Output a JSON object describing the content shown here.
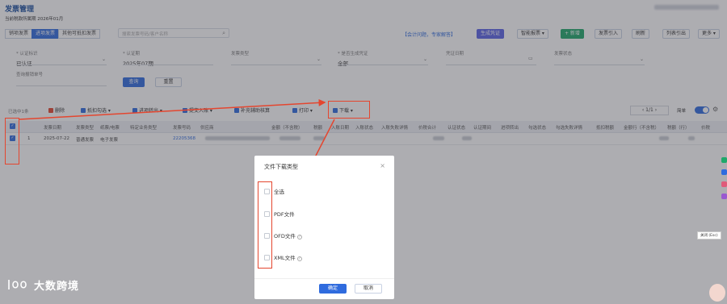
{
  "header": {
    "title": "发票管理",
    "subtitle": "当前税款所属期 2026年01月"
  },
  "tabs": [
    {
      "label": "销项发票"
    },
    {
      "label": "进项发票"
    },
    {
      "label": "其他可抵扣发票"
    }
  ],
  "search": {
    "placeholder": "搜索发票号码/客户名称"
  },
  "help_link": "【会计问题，专家解答】",
  "top_actions": {
    "generate": "生成凭证",
    "smart": "智能报票",
    "add": "+ 新增",
    "import": "发票引入",
    "refresh": "刷新",
    "export": "列表引出",
    "more": "更多"
  },
  "filters": {
    "cert_label": "* 认证标识",
    "cert_value": "已认证",
    "period_label": "* 认证期",
    "period_value": "2025年07期",
    "type_label": "发票类型",
    "voucher_label": "* 是否生成凭证",
    "voucher_value": "全部",
    "date_label": "凭证日期",
    "status_label": "发票状态",
    "invoice_no_label": "查询报销单号"
  },
  "buttons": {
    "query": "查询",
    "reset": "重置"
  },
  "toolbar": {
    "selected": "已选中1条",
    "delete": "删除",
    "deduct": "抵扣勾选",
    "transfer": "进项转出",
    "submit": "提交入账",
    "supplement": "补充辅助核算",
    "print": "打印",
    "download": "下载"
  },
  "pager": {
    "text": "1/1"
  },
  "toggle_label": "简单",
  "table": {
    "headers": [
      "发票日期",
      "发票类型",
      "纸票/电票",
      "特定业务类型",
      "发票号码",
      "供应商",
      "金额（不含税）",
      "税额",
      "入账日期",
      "入账状态",
      "入账失败详情",
      "价税合计",
      "认证状态",
      "认证期间",
      "进项转出",
      "勾选状态",
      "勾选失败详情",
      "抵扣税额",
      "金额行（不含税）",
      "税额（行）",
      "价税"
    ],
    "row": {
      "index": "1",
      "date": "2025-07-22",
      "type": "普通发票",
      "paper": "电子发票",
      "number": "22205368"
    }
  },
  "modal": {
    "title": "文件下载类型",
    "options": [
      "全选",
      "PDF文件",
      "OFD文件",
      "XML文件"
    ],
    "ok": "确定",
    "cancel": "取消"
  },
  "tooltip": "关闭 (Esc)",
  "watermark": "大数跨境",
  "colors": {
    "primary": "#2f6bde",
    "annotation": "#e4462f",
    "green": "#1fa86a"
  }
}
